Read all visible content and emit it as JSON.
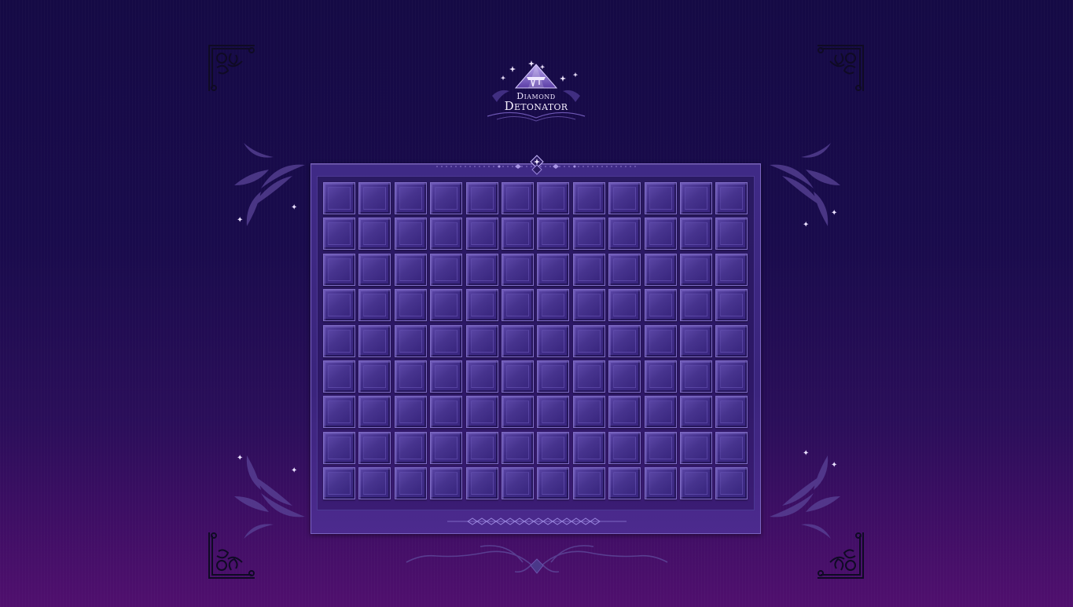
{
  "game": {
    "title_line1": "Diamond",
    "title_line2": "Detonator"
  },
  "board": {
    "columns": 12,
    "rows": 9,
    "cells": 108
  },
  "colors": {
    "background_top": "#150a45",
    "background_bottom": "#500f6e",
    "frame": "#3f2a86",
    "cell": "#4a3594",
    "cell_border": "#7f6cc6"
  },
  "icons": {
    "logo": "diamond-logo-icon",
    "corners": "ornate-corner-icon",
    "flourish": "leaf-flourish-icon",
    "sparkle": "sparkle-icon"
  }
}
